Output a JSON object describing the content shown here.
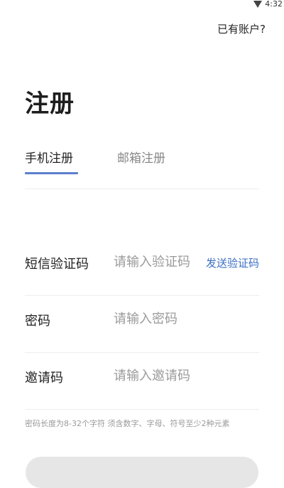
{
  "status_bar": {
    "time": "4:32",
    "icons": [
      "wifi-icon"
    ]
  },
  "header": {
    "login_link": "已有账户?"
  },
  "page": {
    "title": "注册"
  },
  "tabs": [
    {
      "label": "手机注册",
      "active": true
    },
    {
      "label": "邮箱注册",
      "active": false
    }
  ],
  "form": {
    "sms_code": {
      "label": "短信验证码",
      "placeholder": "请输入验证码",
      "send_button": "发送验证码"
    },
    "password": {
      "label": "密码",
      "placeholder": "请输入密码"
    },
    "invite_code": {
      "label": "邀请码",
      "placeholder": "请输入邀请码"
    },
    "hint": "密码长度为8-32个字符 须含数字、字母、符号至少2种元素"
  },
  "colors": {
    "accent": "#5b7fcf",
    "link": "#3b6fc4",
    "placeholder": "#9a9a9a",
    "divider": "#eeeeee",
    "button_disabled": "#e6e6e6"
  }
}
